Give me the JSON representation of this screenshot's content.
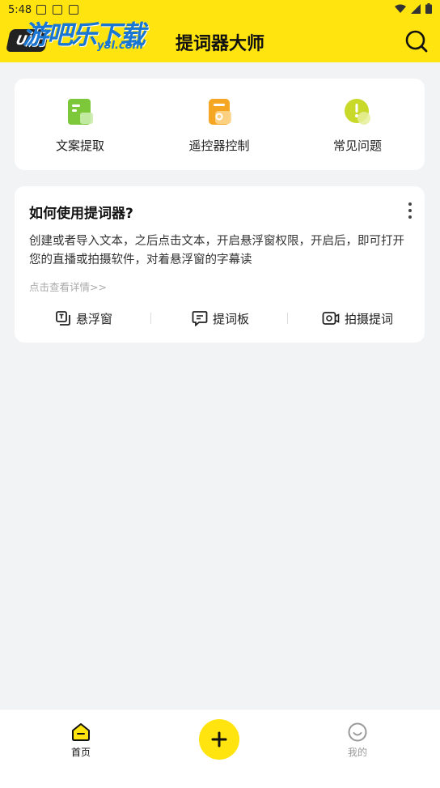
{
  "status_bar": {
    "time": "5:48"
  },
  "watermark": {
    "text": "游吧乐下载",
    "sub": "y8l.com",
    "badge": "UU"
  },
  "header": {
    "title": "提词器大师",
    "search_icon": "search-icon"
  },
  "quick_actions": [
    {
      "label": "文案提取",
      "icon": "document-extract-icon",
      "color": "#7cc83a"
    },
    {
      "label": "遥控器控制",
      "icon": "remote-control-icon",
      "color": "#f5a623"
    },
    {
      "label": "常见问题",
      "icon": "faq-icon",
      "color": "#c8d92a"
    }
  ],
  "guide": {
    "title": "如何使用提词器?",
    "description": "创建或者导入文本，之后点击文本，开启悬浮窗权限，开启后，即可打开您的直播或拍摄软件，对着悬浮窗的字幕读",
    "link": "点击查看详情>>",
    "actions": [
      {
        "label": "悬浮窗",
        "icon": "floating-window-icon"
      },
      {
        "label": "提词板",
        "icon": "prompter-board-icon"
      },
      {
        "label": "拍摄提词",
        "icon": "camera-prompt-icon"
      }
    ]
  },
  "bottom_nav": {
    "home": "首页",
    "add_icon": "plus-icon",
    "mine": "我的"
  },
  "colors": {
    "accent": "#ffe40f",
    "background": "#f2f3f5"
  }
}
